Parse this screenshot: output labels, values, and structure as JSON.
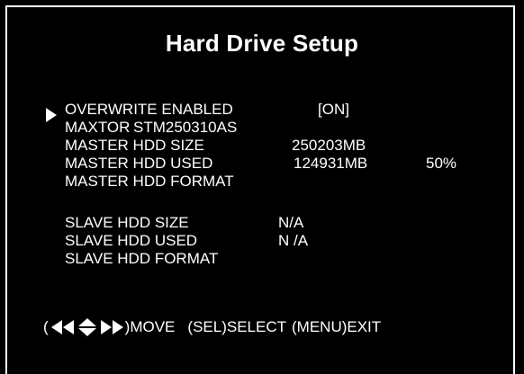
{
  "title": "Hard Drive Setup",
  "overwrite": {
    "label": "OVERWRITE ENABLED",
    "value": "[ON]"
  },
  "master": {
    "model_brand": "MAXTOR",
    "model_number": "STM250310AS",
    "size_label": "MASTER HDD SIZE",
    "size_value": "250203MB",
    "used_label": "MASTER HDD USED",
    "used_value": "124931MB",
    "used_percent": "50%",
    "format_label": "MASTER HDD FORMAT"
  },
  "slave": {
    "size_label": "SLAVE HDD SIZE",
    "size_value": "N/A",
    "used_label": "SLAVE HDD USED",
    "used_value": "N /A",
    "format_label": "SLAVE HDD FORMAT"
  },
  "footer": {
    "open_paren": "(",
    "move_text": ")MOVE",
    "select_text": "(SEL)SELECT",
    "exit_text": "(MENU)EXIT"
  },
  "icons": {
    "cursor": "triangle-right-icon",
    "nav": [
      "triangle-left-icon",
      "triangle-left-icon",
      "triangle-up-icon",
      "triangle-down-icon",
      "triangle-right-icon",
      "triangle-right-icon"
    ]
  }
}
